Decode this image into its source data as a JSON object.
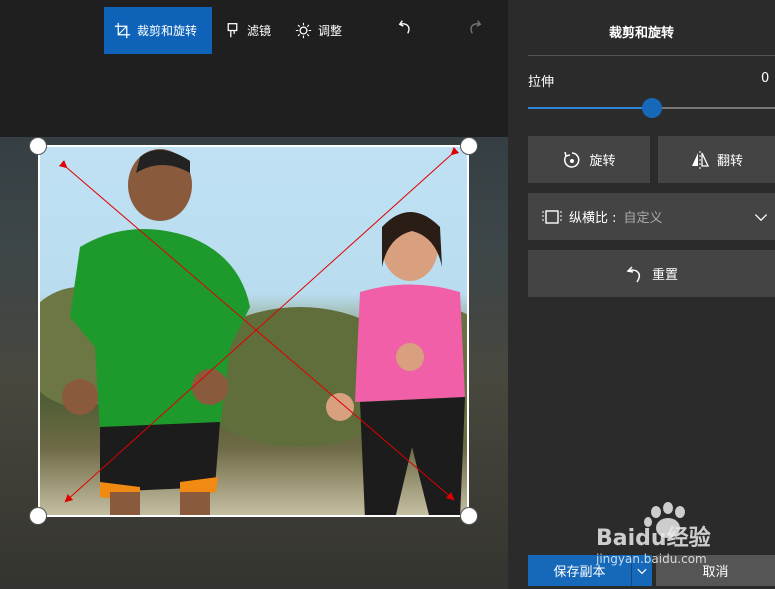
{
  "toolbar": {
    "crop_label": "裁剪和旋转",
    "filter_label": "滤镜",
    "adjust_label": "调整"
  },
  "panel": {
    "title": "裁剪和旋转",
    "stretch_label": "拉伸",
    "stretch_value": "0",
    "stretch_level": 0.5,
    "rotate_label": "旋转",
    "flip_label": "翻转",
    "aspect_label": "纵横比 :",
    "aspect_value": "自定义",
    "reset_label": "重置",
    "save_label": "保存副本",
    "cancel_label": "取消"
  },
  "watermark": {
    "brand": "Baidu经验",
    "url": "jingyan.baidu.com"
  },
  "colors": {
    "accent": "#0e63b9",
    "annotation": "#e00000"
  }
}
